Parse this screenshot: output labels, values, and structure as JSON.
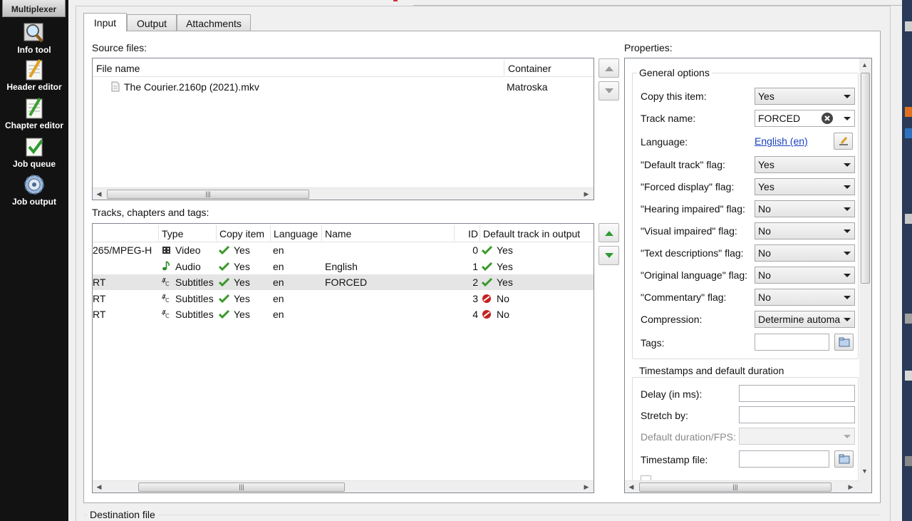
{
  "sidebar": {
    "items": [
      {
        "label": "Multiplexer",
        "icon": "multiplexer-icon"
      },
      {
        "label": "Info tool",
        "icon": "magnifier-icon"
      },
      {
        "label": "Header editor",
        "icon": "pencil-notepad-icon"
      },
      {
        "label": "Chapter editor",
        "icon": "chapter-notepad-icon"
      },
      {
        "label": "Job queue",
        "icon": "checklist-icon"
      },
      {
        "label": "Job output",
        "icon": "gear-icon"
      }
    ]
  },
  "tabs": [
    {
      "label": "Input",
      "active": true
    },
    {
      "label": "Output",
      "active": false
    },
    {
      "label": "Attachments",
      "active": false
    }
  ],
  "source_files": {
    "label": "Source files:",
    "columns": [
      "File name",
      "Container"
    ],
    "rows": [
      {
        "file_name": "The Courier.2160p (2021).mkv",
        "container": "Matroska"
      }
    ]
  },
  "tracks": {
    "label": "Tracks, chapters and tags:",
    "columns": [
      "Type",
      "Copy item",
      "Language",
      "Name",
      "ID",
      "Default track in output"
    ],
    "rows": [
      {
        "codec": "265/MPEG-H",
        "type": "Video",
        "type_icon": "video-icon",
        "copy": "Yes",
        "language": "en",
        "name": "",
        "id": "0",
        "default": "Yes",
        "default_state": "yes",
        "selected": false
      },
      {
        "codec": "",
        "type": "Audio",
        "type_icon": "audio-note-icon",
        "copy": "Yes",
        "language": "en",
        "name": "English",
        "id": "1",
        "default": "Yes",
        "default_state": "yes",
        "selected": false
      },
      {
        "codec": "RT",
        "type": "Subtitles",
        "type_icon": "subtitles-icon",
        "copy": "Yes",
        "language": "en",
        "name": "FORCED",
        "id": "2",
        "default": "Yes",
        "default_state": "yes",
        "selected": true
      },
      {
        "codec": "RT",
        "type": "Subtitles",
        "type_icon": "subtitles-icon",
        "copy": "Yes",
        "language": "en",
        "name": "",
        "id": "3",
        "default": "No",
        "default_state": "no",
        "selected": false
      },
      {
        "codec": "RT",
        "type": "Subtitles",
        "type_icon": "subtitles-icon",
        "copy": "Yes",
        "language": "en",
        "name": "",
        "id": "4",
        "default": "No",
        "default_state": "no",
        "selected": false
      }
    ]
  },
  "properties": {
    "label": "Properties:",
    "general": {
      "title": "General options",
      "copy_item": {
        "label": "Copy this item:",
        "value": "Yes"
      },
      "track_name": {
        "label": "Track name:",
        "value": "FORCED"
      },
      "language": {
        "label": "Language:",
        "value": "English (en)"
      },
      "default_flag": {
        "label": "\"Default track\" flag:",
        "value": "Yes"
      },
      "forced_flag": {
        "label": "\"Forced display\" flag:",
        "value": "Yes"
      },
      "hearing_flag": {
        "label": "\"Hearing impaired\" flag:",
        "value": "No"
      },
      "visual_flag": {
        "label": "\"Visual impaired\" flag:",
        "value": "No"
      },
      "text_desc_flag": {
        "label": "\"Text descriptions\" flag:",
        "value": "No"
      },
      "original_lang_flag": {
        "label": "\"Original language\" flag:",
        "value": "No"
      },
      "commentary_flag": {
        "label": "\"Commentary\" flag:",
        "value": "No"
      },
      "compression": {
        "label": "Compression:",
        "value": "Determine automa"
      },
      "tags": {
        "label": "Tags:",
        "value": ""
      }
    },
    "timestamps": {
      "title": "Timestamps and default duration",
      "delay": {
        "label": "Delay (in ms):",
        "value": ""
      },
      "stretch": {
        "label": "Stretch by:",
        "value": ""
      },
      "default_duration": {
        "label": "Default duration/FPS:",
        "value": ""
      },
      "timestamp_file": {
        "label": "Timestamp file:",
        "value": ""
      }
    }
  },
  "destination": {
    "label": "Destination file"
  },
  "colors": {
    "sidebar_bg": "#121212",
    "selected_row": "#e5e5e5",
    "check_green": "#3a9a2a",
    "no_red": "#c62020",
    "link_blue": "#1a3fc0"
  }
}
